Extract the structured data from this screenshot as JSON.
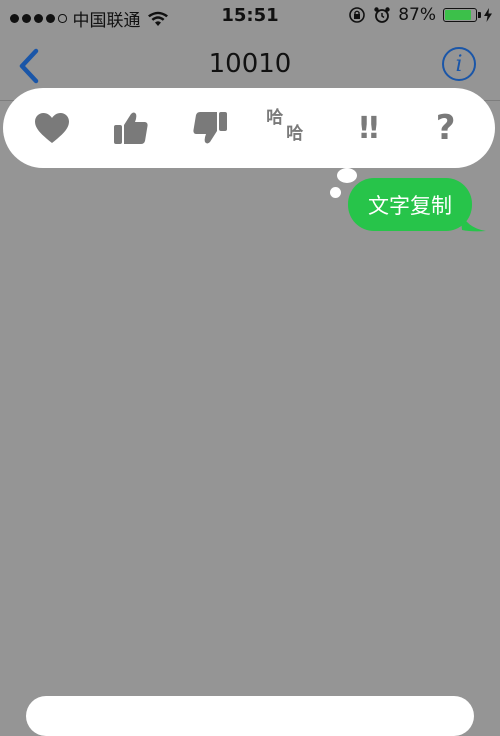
{
  "status_bar": {
    "signal_dots": [
      true,
      true,
      true,
      true,
      false
    ],
    "carrier": "中国联通",
    "time": "15:51",
    "battery_percent": "87%",
    "battery_level": 0.87
  },
  "nav": {
    "title": "10010",
    "back_icon": "chevron-left-icon",
    "info_icon": "info-icon"
  },
  "tapbacks": [
    {
      "name": "heart",
      "icon": "heart-icon"
    },
    {
      "name": "thumbs-up",
      "icon": "thumbs-up-icon"
    },
    {
      "name": "thumbs-down",
      "icon": "thumbs-down-icon"
    },
    {
      "name": "haha",
      "icon": "haha-icon",
      "label": "哈"
    },
    {
      "name": "emphasize",
      "icon": "exclamation-icon",
      "label": "!!"
    },
    {
      "name": "question",
      "icon": "question-icon",
      "label": "?"
    }
  ],
  "message": {
    "text": "文字复制",
    "color": "#27c44a"
  },
  "colors": {
    "background": "#959595",
    "accent": "#1a56a8",
    "icon_gray": "#7a7a7a"
  }
}
